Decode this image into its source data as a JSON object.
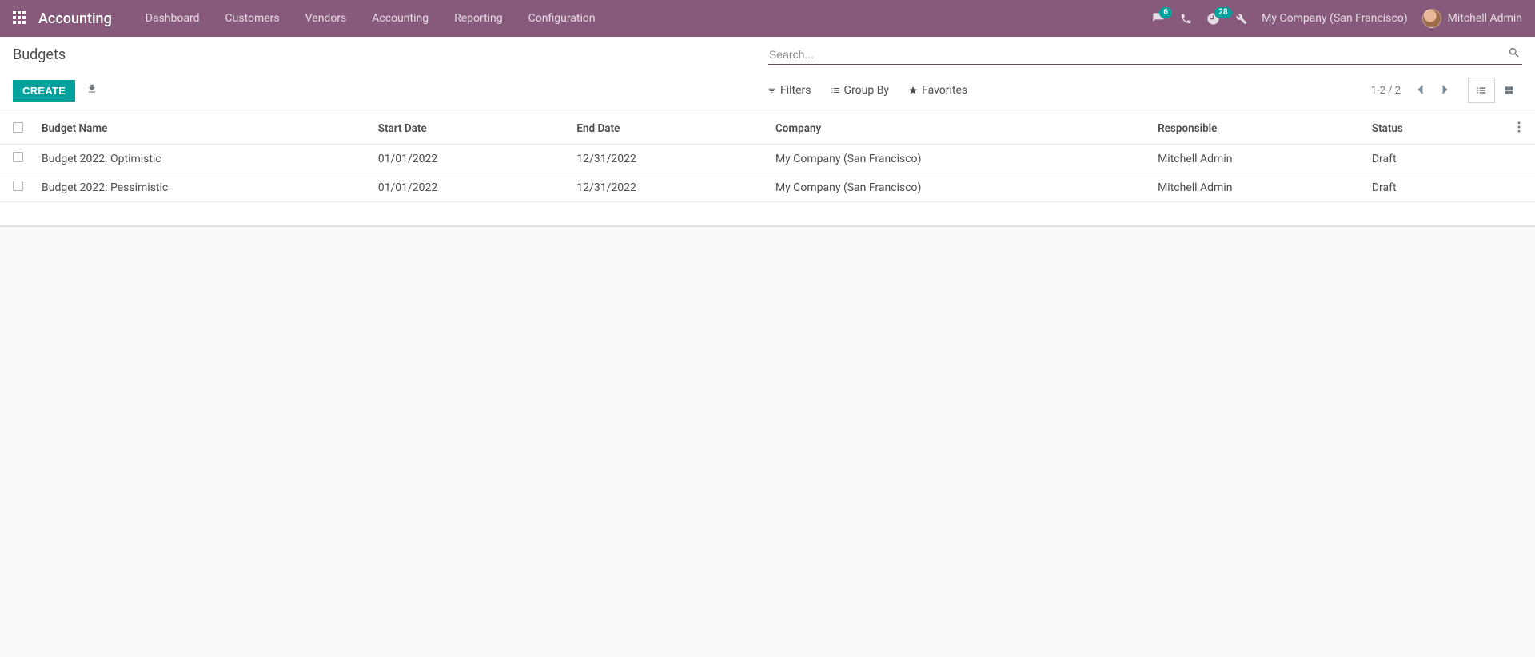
{
  "navbar": {
    "brand": "Accounting",
    "menu": [
      "Dashboard",
      "Customers",
      "Vendors",
      "Accounting",
      "Reporting",
      "Configuration"
    ],
    "messages_badge": "6",
    "activities_badge": "28",
    "company": "My Company (San Francisco)",
    "user": "Mitchell Admin"
  },
  "control": {
    "breadcrumb": "Budgets",
    "search_placeholder": "Search...",
    "create_label": "Create",
    "filters_label": "Filters",
    "groupby_label": "Group By",
    "favorites_label": "Favorites",
    "pager": "1-2 / 2"
  },
  "table": {
    "headers": {
      "name": "Budget Name",
      "start": "Start Date",
      "end": "End Date",
      "company": "Company",
      "responsible": "Responsible",
      "status": "Status"
    },
    "rows": [
      {
        "name": "Budget 2022: Optimistic",
        "start": "01/01/2022",
        "end": "12/31/2022",
        "company": "My Company (San Francisco)",
        "responsible": "Mitchell Admin",
        "status": "Draft"
      },
      {
        "name": "Budget 2022: Pessimistic",
        "start": "01/01/2022",
        "end": "12/31/2022",
        "company": "My Company (San Francisco)",
        "responsible": "Mitchell Admin",
        "status": "Draft"
      }
    ]
  }
}
